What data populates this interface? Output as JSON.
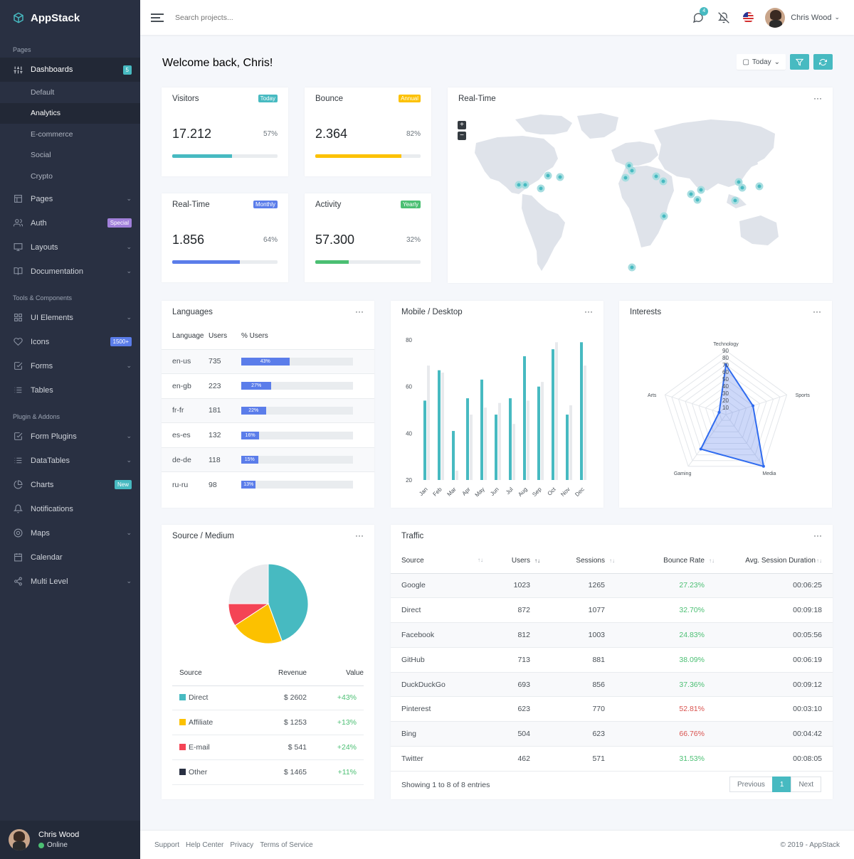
{
  "brand": {
    "name": "AppStack"
  },
  "sidebar": {
    "sections": [
      "Pages",
      "Tools & Components",
      "Plugin & Addons"
    ],
    "dashboards": {
      "label": "Dashboards",
      "badge": "5",
      "sub": [
        "Default",
        "Analytics",
        "E-commerce",
        "Social",
        "Crypto"
      ]
    },
    "pages": "Pages",
    "auth": "Auth",
    "auth_badge": "Special",
    "layouts": "Layouts",
    "documentation": "Documentation",
    "ui": "UI Elements",
    "icons": "Icons",
    "icons_badge": "1500+",
    "forms": "Forms",
    "tables": "Tables",
    "formplugins": "Form Plugins",
    "datatables": "DataTables",
    "charts": "Charts",
    "charts_badge": "New",
    "notifications": "Notifications",
    "maps": "Maps",
    "calendar": "Calendar",
    "multilevel": "Multi Level",
    "user": {
      "name": "Chris Wood",
      "status": "Online"
    }
  },
  "topbar": {
    "search_placeholder": "Search projects...",
    "messages_count": "4",
    "user": "Chris Wood"
  },
  "header": {
    "welcome": "Welcome back, Chris!",
    "today": "Today"
  },
  "stats": [
    {
      "title": "Visitors",
      "tag": "Today",
      "value": "17.212",
      "pct": "57%",
      "fill": 0.57,
      "color": "#47bac1",
      "tagcolor": "#47bac1"
    },
    {
      "title": "Bounce",
      "tag": "Annual",
      "value": "2.364",
      "pct": "82%",
      "fill": 0.82,
      "color": "#fcc100",
      "tagcolor": "#fcc100"
    },
    {
      "title": "Real-Time",
      "tag": "Monthly",
      "value": "1.856",
      "pct": "64%",
      "fill": 0.64,
      "color": "#5b7dea",
      "tagcolor": "#5b7dea"
    },
    {
      "title": "Activity",
      "tag": "Yearly",
      "value": "57.300",
      "pct": "32%",
      "fill": 0.32,
      "color": "#4bbf73",
      "tagcolor": "#4bbf73"
    }
  ],
  "realtime": {
    "title": "Real-Time",
    "zoom_in": "+",
    "zoom_out": "−"
  },
  "languages": {
    "title": "Languages",
    "headers": [
      "Language",
      "Users",
      "% Users"
    ],
    "rows": [
      {
        "lang": "en-us",
        "users": "735",
        "pct": "43%",
        "v": 0.43
      },
      {
        "lang": "en-gb",
        "users": "223",
        "pct": "27%",
        "v": 0.27
      },
      {
        "lang": "fr-fr",
        "users": "181",
        "pct": "22%",
        "v": 0.22
      },
      {
        "lang": "es-es",
        "users": "132",
        "pct": "16%",
        "v": 0.16
      },
      {
        "lang": "de-de",
        "users": "118",
        "pct": "15%",
        "v": 0.15
      },
      {
        "lang": "ru-ru",
        "users": "98",
        "pct": "13%",
        "v": 0.13
      }
    ]
  },
  "mobile": {
    "title": "Mobile / Desktop"
  },
  "interests": {
    "title": "Interests"
  },
  "source": {
    "title": "Source / Medium",
    "headers": [
      "Source",
      "Revenue",
      "Value"
    ],
    "rows": [
      {
        "name": "Direct",
        "revenue": "$ 2602",
        "value": "+43%",
        "color": "#47bac1"
      },
      {
        "name": "Affiliate",
        "revenue": "$ 1253",
        "value": "+13%",
        "color": "#fcc100"
      },
      {
        "name": "E-mail",
        "revenue": "$ 541",
        "value": "+24%",
        "color": "#f44455"
      },
      {
        "name": "Other",
        "revenue": "$ 1465",
        "value": "+11%",
        "color": "#293042"
      }
    ]
  },
  "traffic": {
    "title": "Traffic",
    "headers": [
      "Source",
      "Users",
      "Sessions",
      "Bounce Rate",
      "Avg. Session Duration"
    ],
    "rows": [
      {
        "source": "Google",
        "users": "1023",
        "sessions": "1265",
        "bounce": "27.23%",
        "dur": "00:06:25",
        "good": true
      },
      {
        "source": "Direct",
        "users": "872",
        "sessions": "1077",
        "bounce": "32.70%",
        "dur": "00:09:18",
        "good": true
      },
      {
        "source": "Facebook",
        "users": "812",
        "sessions": "1003",
        "bounce": "24.83%",
        "dur": "00:05:56",
        "good": true
      },
      {
        "source": "GitHub",
        "users": "713",
        "sessions": "881",
        "bounce": "38.09%",
        "dur": "00:06:19",
        "good": true
      },
      {
        "source": "DuckDuckGo",
        "users": "693",
        "sessions": "856",
        "bounce": "37.36%",
        "dur": "00:09:12",
        "good": true
      },
      {
        "source": "Pinterest",
        "users": "623",
        "sessions": "770",
        "bounce": "52.81%",
        "dur": "00:03:10",
        "good": false
      },
      {
        "source": "Bing",
        "users": "504",
        "sessions": "623",
        "bounce": "66.76%",
        "dur": "00:04:42",
        "good": false
      },
      {
        "source": "Twitter",
        "users": "462",
        "sessions": "571",
        "bounce": "31.53%",
        "dur": "00:08:05",
        "good": true
      }
    ],
    "showing": "Showing 1 to 8 of 8 entries",
    "prev": "Previous",
    "page": "1",
    "next": "Next"
  },
  "footer": {
    "links": [
      "Support",
      "Help Center",
      "Privacy",
      "Terms of Service"
    ],
    "copyright": "© 2019 - AppStack"
  },
  "chart_data": [
    {
      "type": "bar",
      "name": "mobile-desktop",
      "categories": [
        "Jan",
        "Feb",
        "Mar",
        "Apr",
        "May",
        "Jun",
        "Jul",
        "Aug",
        "Sep",
        "Oct",
        "Nov",
        "Dec"
      ],
      "series": [
        {
          "values": [
            54,
            67,
            41,
            55,
            63,
            48,
            55,
            73,
            60,
            76,
            48,
            79
          ],
          "color": "#47bac1"
        },
        {
          "values": [
            69,
            66,
            24,
            48,
            51,
            53,
            44,
            54,
            62,
            79,
            52,
            69
          ],
          "color": "#e8eaed"
        }
      ],
      "ylim": [
        20,
        80
      ],
      "yticks": [
        20,
        40,
        60,
        80
      ]
    },
    {
      "type": "radar",
      "name": "interests",
      "axes": [
        "Technology",
        "Sports",
        "Media",
        "Gaming",
        "Arts"
      ],
      "rlim": [
        0,
        90
      ],
      "rticks": [
        10,
        20,
        30,
        40,
        50,
        60,
        70,
        80,
        90
      ],
      "values": [
        70,
        40,
        90,
        60,
        10
      ]
    },
    {
      "type": "pie",
      "name": "source",
      "values": [
        2602,
        1253,
        541,
        1465
      ],
      "colors": [
        "#47bac1",
        "#fcc100",
        "#f44455",
        "#e9eaed"
      ]
    }
  ]
}
